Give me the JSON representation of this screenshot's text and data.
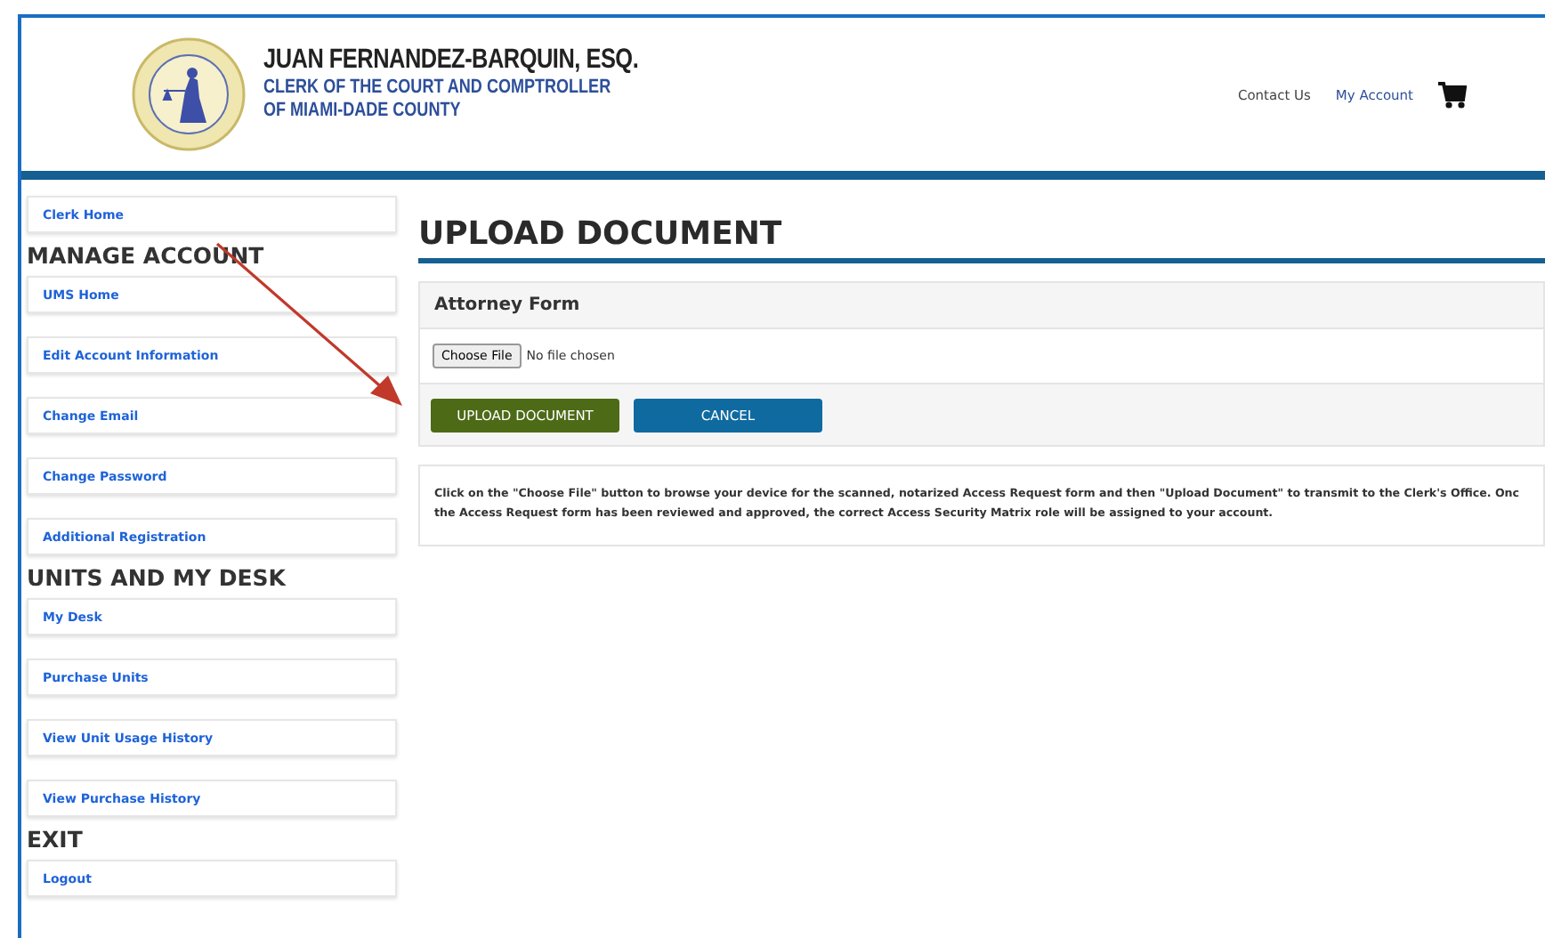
{
  "header": {
    "name": "JUAN FERNANDEZ-BARQUIN, ESQ.",
    "subtitle_lines": [
      "CLERK OF THE COURT AND COMPTROLLER",
      "OF MIAMI-DADE COUNTY"
    ],
    "nav": [
      "Contact Us",
      "My Account"
    ]
  },
  "sidebar": [
    {
      "items": [
        "Clerk Home"
      ]
    },
    {
      "heading": "MANAGE ACCOUNT",
      "items": [
        "UMS Home",
        "Edit Account Information",
        "Change Email",
        "Change Password",
        "Additional Registration"
      ]
    },
    {
      "heading": "UNITS AND MY DESK",
      "items": [
        "My Desk",
        "Purchase Units",
        "View Unit Usage History",
        "View Purchase History"
      ]
    },
    {
      "heading": "EXIT",
      "items": [
        "Logout"
      ]
    }
  ],
  "page": {
    "title": "UPLOAD DOCUMENT",
    "form_title": "Attorney Form",
    "file_button": "Choose File",
    "file_status": "No file chosen",
    "buttons": [
      {
        "label": "UPLOAD DOCUMENT",
        "kind": "primary"
      },
      {
        "label": "CANCEL",
        "kind": "secondary"
      }
    ],
    "instructions": "Click on the \"Choose File\" button to browse your device for the scanned, notarized Access Request form and then \"Upload Document\" to transmit to the Clerk's Office. Onc\nthe Access Request form has been reviewed and approved, the correct Access Security Matrix role will be assigned to your account."
  }
}
